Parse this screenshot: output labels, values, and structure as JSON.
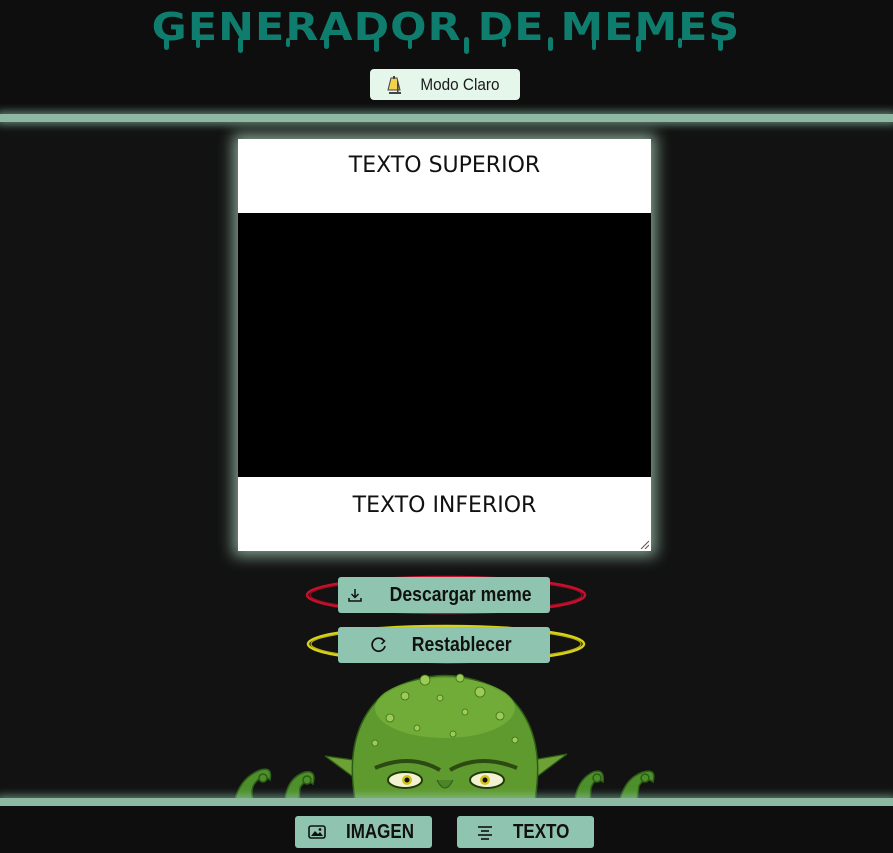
{
  "header": {
    "title": "GENERADOR DE MEMES",
    "mode_toggle": {
      "label": "Modo Claro",
      "icon": "lamp-icon"
    }
  },
  "meme": {
    "top_text": "TEXTO SUPERIOR",
    "bottom_text": "TEXTO INFERIOR"
  },
  "actions": {
    "download": {
      "label": "Descargar meme",
      "icon": "download-icon"
    },
    "reset": {
      "label": "Restablecer",
      "icon": "refresh-icon"
    }
  },
  "footer": {
    "image_tab": {
      "label": "IMAGEN",
      "icon": "image-icon"
    },
    "text_tab": {
      "label": "TEXTO",
      "icon": "align-text-icon"
    }
  },
  "colors": {
    "title": "#0f7d6d",
    "accent_button": "#8fc4b1",
    "mode_button": "#e5f6ea",
    "background": "#121212",
    "download_ring": "#c8102e",
    "reset_ring": "#d6d21a"
  }
}
